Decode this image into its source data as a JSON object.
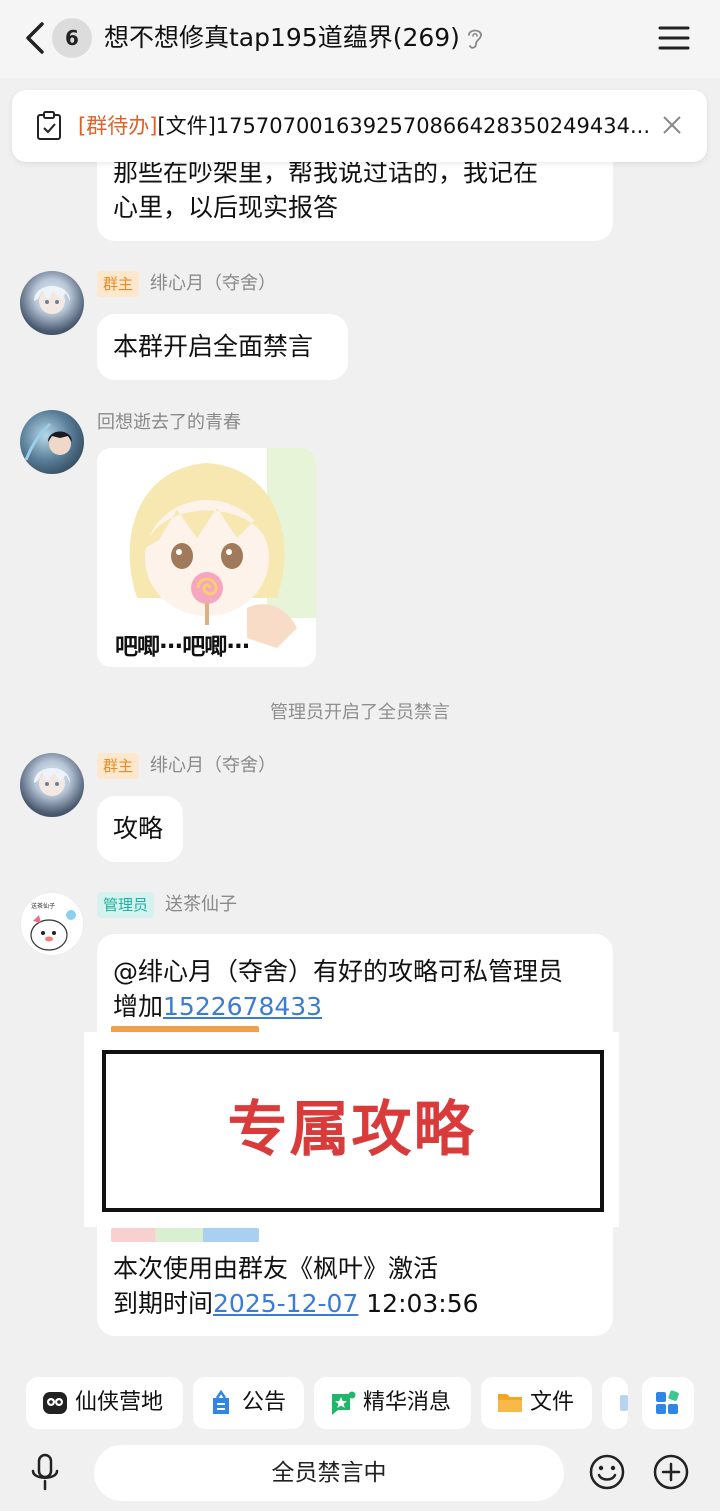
{
  "header": {
    "unread_count": "6",
    "title": "想不想修真tap195道蕴界(269)"
  },
  "pinned_notice": {
    "tag": "[群待办]",
    "text": "[文件]1757070016392570866428350249434...."
  },
  "messages": {
    "m0": {
      "lines": [
        "那些在吵架里，帮我说过话的，我记在",
        "心里，以后现实报答"
      ]
    },
    "m1": {
      "badge": "群主",
      "sender": "绯心月（夺舍）",
      "text": "本群开启全面禁言"
    },
    "m2": {
      "sender": "回想逝去了的青春",
      "sticker_caption": "吧唧···吧唧···"
    },
    "system": "管理员开启了全员禁言",
    "m3": {
      "badge": "群主",
      "sender": "绯心月（夺舍）",
      "text": "攻略"
    },
    "m4": {
      "badge": "管理员",
      "sender": "送茶仙子",
      "line1": "@绯心月（夺舍）有好的攻略可私管理员",
      "line2_prefix": "增加",
      "line2_link": "1522678433",
      "banner_text": "专属攻略",
      "line3": "本次使用由群友《枫叶》激活",
      "line4_prefix": "到期时间",
      "line4_link": "2025-12-07",
      "line4_suffix": " 12:03:56"
    }
  },
  "quick_actions": [
    {
      "label": "仙侠营地",
      "icon": "camp-icon"
    },
    {
      "label": "公告",
      "icon": "announcement-icon"
    },
    {
      "label": "精华消息",
      "icon": "essence-icon"
    },
    {
      "label": "文件",
      "icon": "folder-icon"
    }
  ],
  "input": {
    "placeholder": "全员禁言中"
  },
  "colors": {
    "accent_link": "#3a7bd5",
    "owner_badge": "#ee8a25",
    "admin_badge": "#1fb0a2",
    "banner_red": "#d93a3a"
  }
}
